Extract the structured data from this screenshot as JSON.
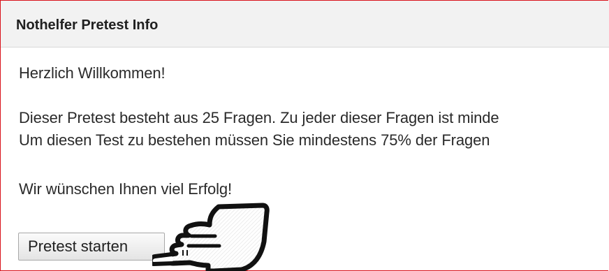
{
  "panel": {
    "title": "Nothelfer Pretest Info",
    "welcome": "Herzlich Willkommen!",
    "info_line1": "Dieser Pretest besteht aus 25 Fragen. Zu jeder dieser Fragen ist minde",
    "info_line2": "Um diesen Test zu bestehen müssen Sie mindestens 75% der Fragen",
    "wish": "Wir wünschen Ihnen viel Erfolg!",
    "start_button_label": "Pretest starten"
  },
  "colors": {
    "frame_border": "#d9131b",
    "header_background": "#f2f2f2",
    "text": "#2a2a2a"
  },
  "icons": {
    "cursor": "pointing-hand-icon"
  }
}
